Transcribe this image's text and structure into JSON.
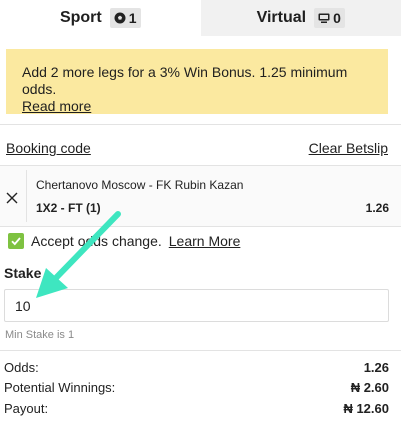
{
  "tabs": [
    {
      "label": "Sport",
      "count": "1",
      "icon": "soccer-ball-icon"
    },
    {
      "label": "Virtual",
      "count": "0",
      "icon": "virtual-screen-icon"
    }
  ],
  "bonus": {
    "message": "Add 2 more legs for a 3% Win Bonus. 1.25 minimum odds.",
    "link": "Read more"
  },
  "links": {
    "booking_code": "Booking code",
    "clear_betslip": "Clear Betslip"
  },
  "bet": {
    "match": "Chertanovo Moscow - FK Rubin Kazan",
    "market": "1X2 - FT (1)",
    "odds": "1.26"
  },
  "accept": {
    "text": "Accept odds change.",
    "link": "Learn More",
    "checked": true
  },
  "stake": {
    "label": "Stake",
    "value": "10",
    "min_text": "Min Stake is 1"
  },
  "summary": {
    "odds_label": "Odds:",
    "odds_value": "1.26",
    "winnings_label": "Potential Winnings:",
    "winnings_value": "₦ 2.60",
    "payout_label": "Payout:",
    "payout_value": "₦ 12.60"
  },
  "colors": {
    "bonus_bg": "#fbe9a0",
    "checkbox": "#7ec241",
    "annotation_arrow": "#3ee6c0"
  }
}
